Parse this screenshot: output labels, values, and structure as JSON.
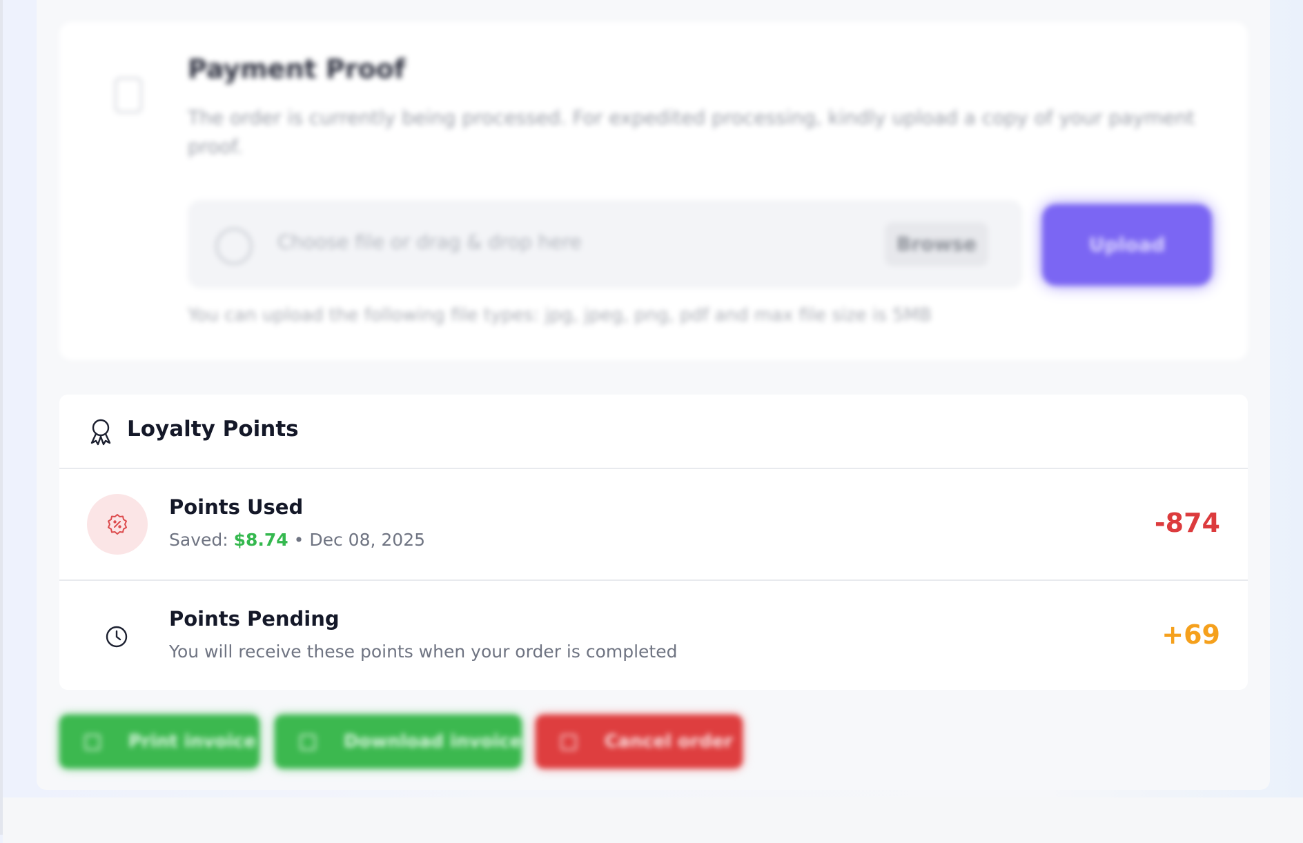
{
  "payment_proof": {
    "title": "Payment Proof",
    "description": "The order is currently being processed. For expedited processing, kindly upload a copy of your payment proof.",
    "dropzone_text": "Choose file or drag & drop here",
    "browse_label": "Browse",
    "upload_label": "Upload",
    "hint": "You can upload the following file types: jpg, jpeg, png, pdf and max file size is 5MB"
  },
  "loyalty": {
    "title": "Loyalty Points",
    "header_icon": "award-icon",
    "rows": [
      {
        "title": "Points Used",
        "icon": "discount-badge-icon",
        "saved_prefix": "Saved:",
        "saved_amount": "$8.74",
        "separator": "•",
        "date": "Dec 08, 2025",
        "value": "-874",
        "value_color": "#dc3b3d"
      },
      {
        "title": "Points Pending",
        "icon": "clock-icon",
        "subtitle": "You will receive these points when your order is completed",
        "value": "+69",
        "value_color": "#f5a01c"
      }
    ]
  },
  "actions": {
    "print_invoice": "Print invoice",
    "download_invoice": "Download invoice",
    "cancel_order": "Cancel order"
  },
  "colors": {
    "accent_purple": "#7b66f3",
    "success_green": "#3cb84f",
    "danger_red": "#de3e3f"
  }
}
